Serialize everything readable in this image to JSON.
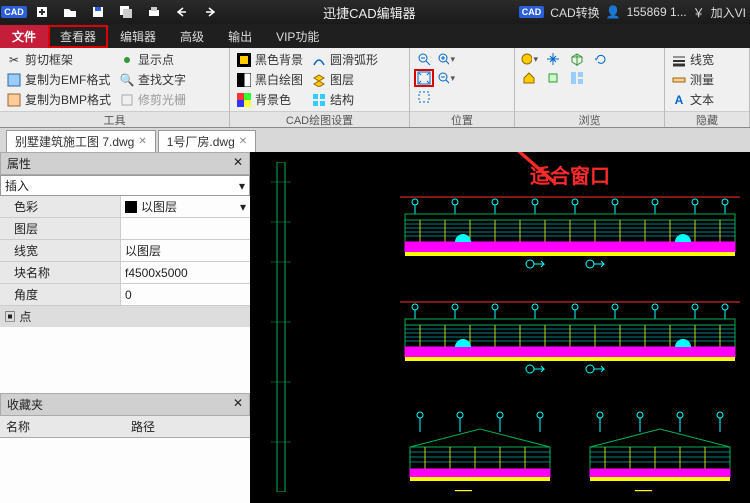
{
  "title": "迅捷CAD编辑器",
  "titlebar_right": {
    "convert": "CAD转换",
    "user": "155869 1...",
    "join": "加入VI"
  },
  "menu": {
    "file": "文件",
    "viewer": "查看器",
    "editor": "编辑器",
    "advanced": "高级",
    "output": "输出",
    "vip": "VIP功能"
  },
  "ribbon": {
    "tools": {
      "label": "工具",
      "crop": "剪切框架",
      "emf": "复制为EMF格式",
      "bmp": "复制为BMP格式",
      "showpt": "显示点",
      "findtext": "查找文字",
      "trimcrop": "修剪光栅"
    },
    "cadset": {
      "label": "CAD绘图设置",
      "blackbg": "黑色背景",
      "bw": "黑白绘图",
      "bgcolor": "背景色",
      "smootharc": "圆滑弧形",
      "layer": "图层",
      "structure": "结构"
    },
    "position": {
      "label": "位置"
    },
    "browse": {
      "label": "浏览"
    },
    "hide": {
      "label": "隐藏",
      "linew": "线宽",
      "measure": "测量",
      "text": "文本"
    }
  },
  "tabs": {
    "t1": "别墅建筑施工图 7.dwg",
    "t2": "1号厂房.dwg"
  },
  "props": {
    "header": "属性",
    "insert": "插入",
    "color_k": "色彩",
    "color_v": "以图层",
    "layer_k": "图层",
    "linew_k": "线宽",
    "linew_v": "以图层",
    "block_k": "块名称",
    "block_v": "f4500x5000",
    "angle_k": "角度",
    "angle_v": "0",
    "point_cat": "点"
  },
  "fav": {
    "header": "收藏夹",
    "name": "名称",
    "path": "路径"
  },
  "annotation": "适合窗口"
}
